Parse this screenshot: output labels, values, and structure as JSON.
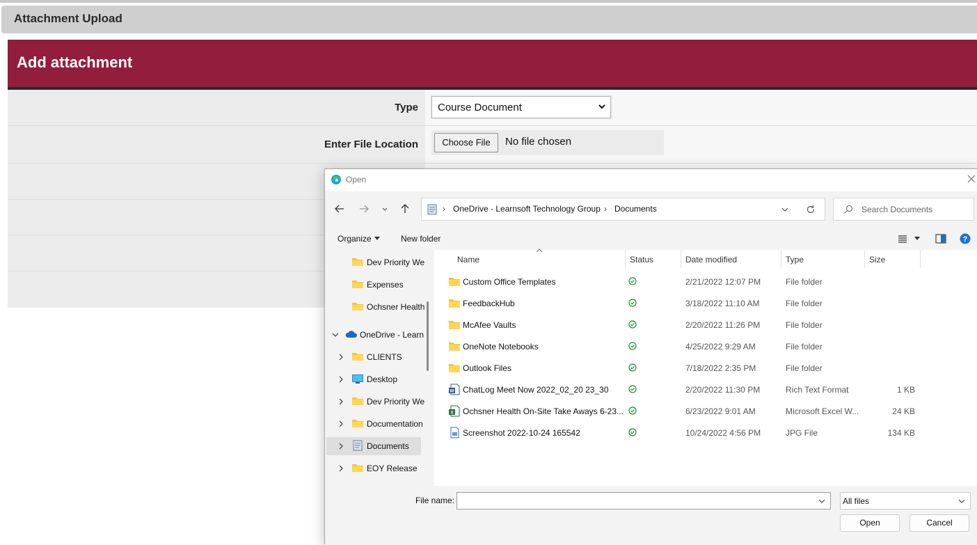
{
  "page": {
    "panel_title": "Attachment Upload",
    "heading": "Add attachment",
    "type_label": "Type",
    "type_value": "Course Document",
    "file_label": "Enter File Location",
    "choose_file_label": "Choose File",
    "no_file_text": "No file chosen",
    "accent_color": "#931d3d"
  },
  "dialog": {
    "title": "Open",
    "breadcrumb": [
      "OneDrive - Learnsoft Technology Group",
      "Documents"
    ],
    "search_placeholder": "Search Documents",
    "organize_label": "Organize",
    "new_folder_label": "New folder",
    "nav_items": [
      {
        "label": "Dev Priority We",
        "icon": "folder-icon"
      },
      {
        "label": "Expenses",
        "icon": "folder-icon"
      },
      {
        "label": "Ochsner Health",
        "icon": "folder-icon"
      },
      {
        "label": "OneDrive - Learn",
        "icon": "onedrive-cloud-icon"
      },
      {
        "label": "CLIENTS",
        "icon": "folder-icon"
      },
      {
        "label": "Desktop",
        "icon": "desktop-icon"
      },
      {
        "label": "Dev Priority We",
        "icon": "folder-icon"
      },
      {
        "label": "Documentation",
        "icon": "folder-icon"
      },
      {
        "label": "Documents",
        "icon": "documents-icon",
        "selected": true
      },
      {
        "label": "EOY Release",
        "icon": "folder-icon"
      }
    ],
    "columns": {
      "name": "Name",
      "status": "Status",
      "date": "Date modified",
      "type": "Type",
      "size": "Size"
    },
    "files": [
      {
        "name": "Custom Office Templates",
        "icon": "folder-icon",
        "date": "2/21/2022 12:07 PM",
        "type": "File folder",
        "size": ""
      },
      {
        "name": "FeedbackHub",
        "icon": "folder-icon",
        "date": "3/18/2022 11:10 AM",
        "type": "File folder",
        "size": ""
      },
      {
        "name": "McAfee Vaults",
        "icon": "folder-icon",
        "date": "2/20/2022 11:26 PM",
        "type": "File folder",
        "size": ""
      },
      {
        "name": "OneNote Notebooks",
        "icon": "folder-icon",
        "date": "4/25/2022 9:29 AM",
        "type": "File folder",
        "size": ""
      },
      {
        "name": "Outlook Files",
        "icon": "folder-icon",
        "date": "7/18/2022 2:35 PM",
        "type": "File folder",
        "size": ""
      },
      {
        "name": "ChatLog Meet Now 2022_02_20 23_30",
        "icon": "word-doc-icon",
        "date": "2/20/2022 11:30 PM",
        "type": "Rich Text Format",
        "size": "1 KB"
      },
      {
        "name": "Ochsner Health On-Site Take Aways  6-23...",
        "icon": "excel-doc-icon",
        "date": "6/23/2022 9:01 AM",
        "type": "Microsoft Excel W...",
        "size": "24 KB"
      },
      {
        "name": "Screenshot 2022-10-24 165542",
        "icon": "image-file-icon",
        "date": "10/24/2022 4:56 PM",
        "type": "JPG File",
        "size": "134 KB"
      }
    ],
    "file_name_label": "File name:",
    "file_name_value": "",
    "filter_value": "All files",
    "open_label": "Open",
    "cancel_label": "Cancel"
  }
}
